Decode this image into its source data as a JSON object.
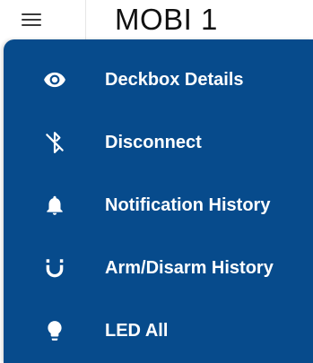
{
  "colors": {
    "menu_background": "#074b8c",
    "menu_text": "#ffffff",
    "appbar_background": "#ffffff",
    "title_text": "#111111"
  },
  "appbar": {
    "menu_icon": "hamburger-menu-icon",
    "title": "MOBI 1"
  },
  "menu": {
    "items": [
      {
        "label": "Deckbox Details",
        "icon": "eye-icon"
      },
      {
        "label": "Disconnect",
        "icon": "bluetooth-disabled-icon"
      },
      {
        "label": "Notification History",
        "icon": "bell-icon"
      },
      {
        "label": "Arm/Disarm History",
        "icon": "magnet-icon"
      },
      {
        "label": "LED All",
        "icon": "lightbulb-icon"
      }
    ]
  }
}
